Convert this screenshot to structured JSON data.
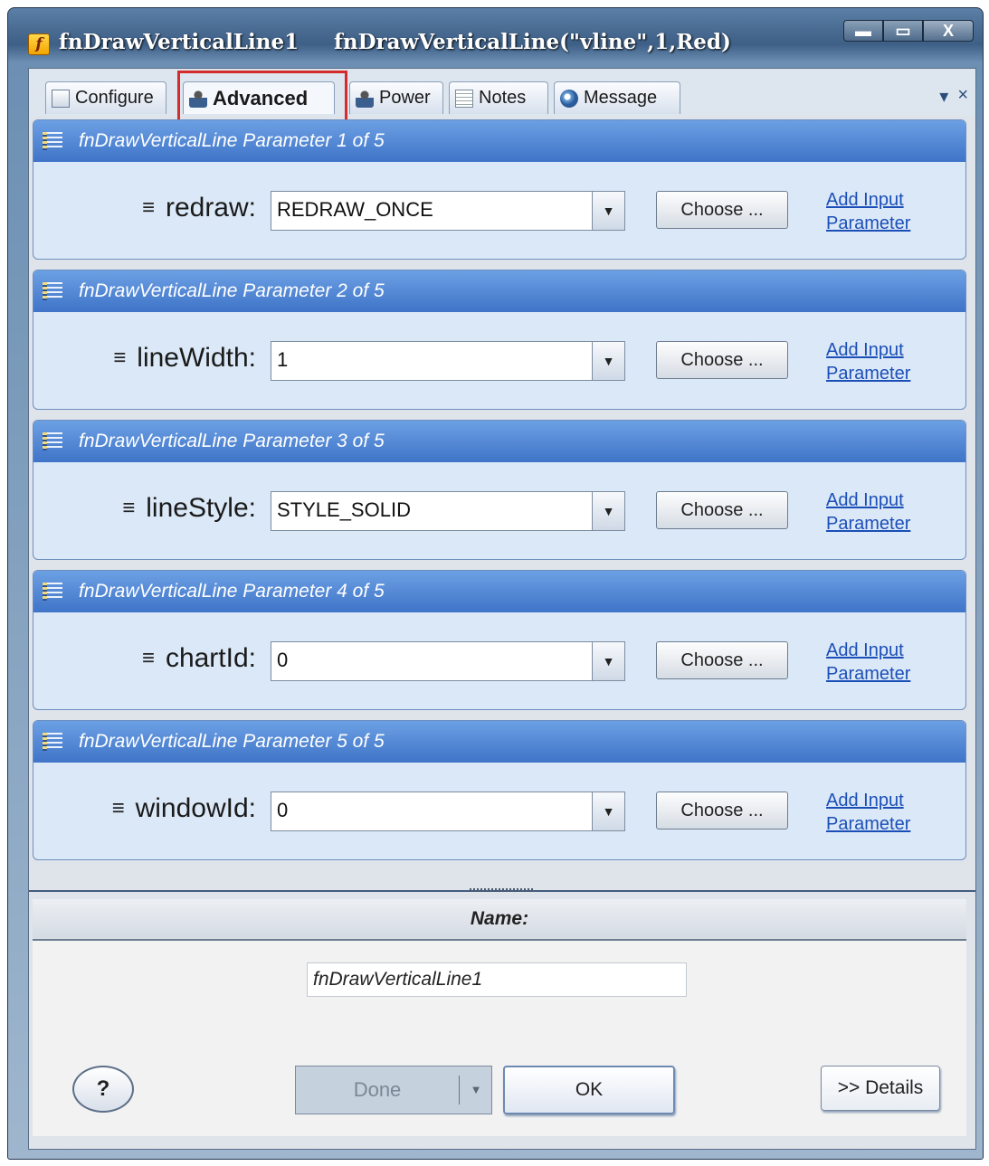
{
  "window": {
    "title_name": "fnDrawVerticalLine1",
    "title_call": "fnDrawVerticalLine(\"vline\",1,Red)",
    "app_icon": "f",
    "controls": [
      "minimize-icon",
      "maximize-icon",
      "close-icon"
    ],
    "close_glyph": "X"
  },
  "tabs": [
    {
      "label": "Configure",
      "icon": "configure-icon"
    },
    {
      "label": "Advanced",
      "icon": "person-icon",
      "active": true,
      "highlighted": true
    },
    {
      "label": "Power",
      "icon": "person-icon"
    },
    {
      "label": "Notes",
      "icon": "notes-icon"
    },
    {
      "label": "Message",
      "icon": "message-icon"
    }
  ],
  "tab_menu": {
    "dropdown": "▾",
    "close": "×"
  },
  "panels": [
    {
      "header": "fnDrawVerticalLine Parameter 1 of 5",
      "label": "redraw:",
      "value": "REDRAW_ONCE",
      "choose": "Choose ...",
      "add_link": "Add Input Parameter"
    },
    {
      "header": "fnDrawVerticalLine Parameter 2 of 5",
      "label": "lineWidth:",
      "value": "1",
      "choose": "Choose ...",
      "add_link": "Add Input Parameter"
    },
    {
      "header": "fnDrawVerticalLine Parameter 3 of 5",
      "label": "lineStyle:",
      "value": "STYLE_SOLID",
      "choose": "Choose ...",
      "add_link": "Add Input Parameter"
    },
    {
      "header": "fnDrawVerticalLine Parameter 4 of 5",
      "label": "chartId:",
      "value": "0",
      "choose": "Choose ...",
      "add_link": "Add Input Parameter"
    },
    {
      "header": "fnDrawVerticalLine Parameter 5 of 5",
      "label": "windowId:",
      "value": "0",
      "choose": "Choose ...",
      "add_link": "Add Input Parameter"
    }
  ],
  "name_section": {
    "header": "Name:",
    "value": "fnDrawVerticalLine1"
  },
  "footer": {
    "help": "?",
    "done": "Done",
    "ok": "OK",
    "details": ">> Details"
  },
  "colors": {
    "highlight": "#d62b2b",
    "panel_header": "#4a80d0",
    "link": "#1b4fb8"
  }
}
